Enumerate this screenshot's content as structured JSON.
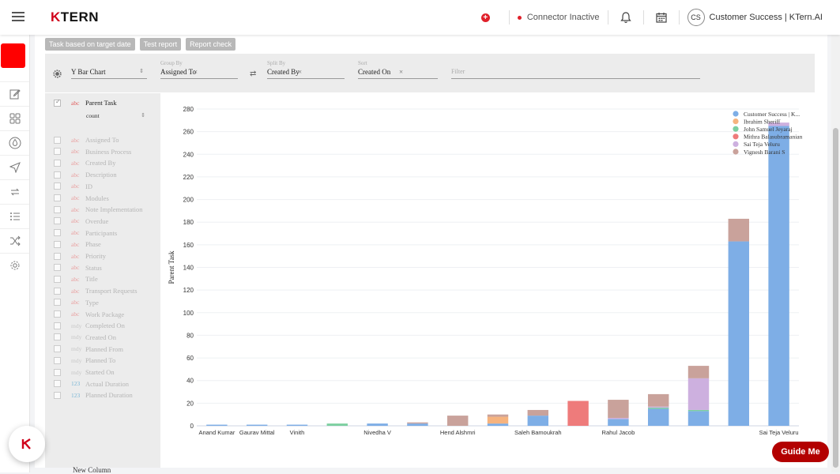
{
  "topbar": {
    "logo_k": "K",
    "logo_rest": "TERN",
    "connector_status": "Connector Inactive",
    "avatar_initials": "CS",
    "user_name": "Customer Success | KTern.AI"
  },
  "toolbar": {
    "buttons": [
      "Task based on target date",
      "Test report",
      "Report check"
    ]
  },
  "config": {
    "chart_type": "Y Bar Chart",
    "group_by_label": "Group By",
    "group_by_value": "Assigned To",
    "split_by_label": "Split By",
    "split_by_value": "Created By",
    "sort_label": "Sort",
    "sort_value": "Created On",
    "filter_placeholder": "Filter"
  },
  "fields": {
    "measure": {
      "type": "abc",
      "label": "Parent Task",
      "agg": "count"
    },
    "list": [
      {
        "type": "abc",
        "label": "Assigned To"
      },
      {
        "type": "abc",
        "label": "Business Process"
      },
      {
        "type": "abc",
        "label": "Created By"
      },
      {
        "type": "abc",
        "label": "Description"
      },
      {
        "type": "abc",
        "label": "ID"
      },
      {
        "type": "abc",
        "label": "Modules"
      },
      {
        "type": "abc",
        "label": "Note Implementation"
      },
      {
        "type": "abc",
        "label": "Overdue"
      },
      {
        "type": "abc",
        "label": "Participants"
      },
      {
        "type": "abc",
        "label": "Phase"
      },
      {
        "type": "abc",
        "label": "Priority"
      },
      {
        "type": "abc",
        "label": "Status"
      },
      {
        "type": "abc",
        "label": "Title"
      },
      {
        "type": "abc",
        "label": "Transport Requests"
      },
      {
        "type": "abc",
        "label": "Type"
      },
      {
        "type": "abc",
        "label": "Work Package"
      },
      {
        "type": "mdy",
        "label": "Completed On"
      },
      {
        "type": "mdy",
        "label": "Created On"
      },
      {
        "type": "mdy",
        "label": "Planned From"
      },
      {
        "type": "mdy",
        "label": "Planned To"
      },
      {
        "type": "mdy",
        "label": "Started On"
      },
      {
        "type": "123",
        "label": "Actual Duration"
      },
      {
        "type": "123",
        "label": "Planned Duration"
      }
    ],
    "new_column": "New Column"
  },
  "guide_label": "Guide Me",
  "chart_data": {
    "type": "bar",
    "stacked": true,
    "ylabel": "Parent Task",
    "ylim": [
      0,
      280
    ],
    "yticks": [
      0,
      20,
      40,
      60,
      80,
      100,
      120,
      140,
      160,
      180,
      200,
      220,
      240,
      260,
      280
    ],
    "grid": true,
    "legend_position": "top-right",
    "x_tick_labels": [
      "Anand Kumar",
      "Gaurav Mittal",
      "Vinith",
      "",
      "Nivedha V",
      "",
      "Hend Alshmri",
      "",
      "Saleh Bamoukrah",
      "",
      "Rahul Jacob",
      "",
      "",
      "",
      "Sai Teja Veluru"
    ],
    "categories": [
      "c1",
      "c2",
      "c3",
      "c4",
      "c5",
      "c6",
      "c7",
      "c8",
      "c9",
      "c10",
      "c11",
      "c12",
      "c13",
      "c14",
      "c15"
    ],
    "series": [
      {
        "name": "Customer Success | K...",
        "color": "#7eaee6",
        "values": [
          1,
          1,
          1,
          0,
          2,
          2,
          0,
          2,
          9,
          0,
          6,
          15,
          13,
          163,
          265
        ]
      },
      {
        "name": "Ibrahim Sheriff",
        "color": "#f6b37e",
        "values": [
          0,
          0,
          0,
          0,
          0,
          0,
          0,
          6,
          0,
          0,
          0,
          0,
          0,
          0,
          0
        ]
      },
      {
        "name": "John Samuel Jeyaraj",
        "color": "#7ccfa0",
        "values": [
          0,
          0,
          0,
          2,
          0,
          0,
          0,
          0,
          0,
          0,
          0,
          1,
          1,
          0,
          0
        ]
      },
      {
        "name": "Mithra Balasubramanian",
        "color": "#ee7b7b",
        "values": [
          0,
          0,
          0,
          0,
          0,
          0,
          0,
          0,
          0,
          22,
          0,
          0,
          0,
          0,
          0
        ]
      },
      {
        "name": "Sai Teja Veluru",
        "color": "#cdb0df",
        "values": [
          0,
          0,
          0,
          0,
          0,
          0,
          0,
          0,
          0,
          0,
          1,
          1,
          28,
          0,
          3
        ]
      },
      {
        "name": "Vignesh Barani S",
        "color": "#c9a29b",
        "values": [
          0,
          0,
          0,
          0,
          0,
          1,
          9,
          2,
          5,
          0,
          16,
          11,
          11,
          20,
          0
        ]
      }
    ]
  }
}
